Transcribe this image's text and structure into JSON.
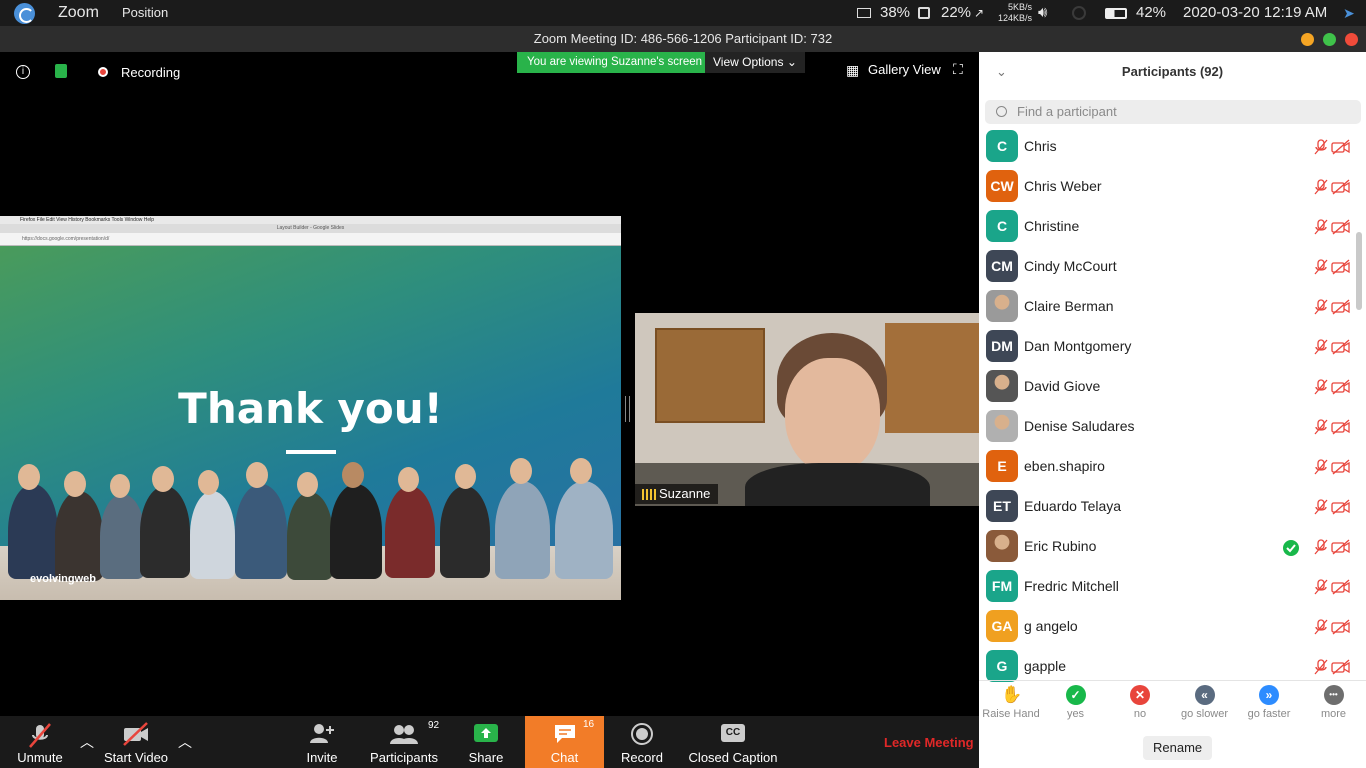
{
  "system": {
    "app_name": "Zoom",
    "menu_position": "Position",
    "battery_indicator": "38%",
    "cpu": "22%",
    "net_up": "5KB/s",
    "net_down": "124KB/s",
    "battery": "42%",
    "datetime": "2020-03-20 12:19 AM"
  },
  "title": "Zoom Meeting ID: 486-566-1206 Participant ID: 732",
  "meeting_controls": {
    "recording": "Recording",
    "viewing_banner": "You are viewing Suzanne's screen",
    "view_options": "View Options",
    "gallery_view": "Gallery View"
  },
  "shared_screen": {
    "browser_menu": "Firefox  File  Edit  View  History  Bookmarks  Tools  Window  Help",
    "browser_tab": "Layout Builder - Google Slides",
    "slide_title": "Thank you!",
    "brand": "evolvingweb"
  },
  "video_tile": {
    "name": "Suzanne"
  },
  "toolbar": {
    "unmute": "Unmute",
    "start_video": "Start Video",
    "invite": "Invite",
    "participants": "Participants",
    "participants_count": "92",
    "share": "Share",
    "chat": "Chat",
    "chat_count": "16",
    "record": "Record",
    "closed_caption": "Closed Caption",
    "cc_icon_text": "CC",
    "leave": "Leave Meeting"
  },
  "panel": {
    "title": "Participants (92)",
    "search_placeholder": "Find a participant",
    "participants": [
      {
        "name": "Chris",
        "initials": "C",
        "color": "#1aa58a",
        "photo": false,
        "check": false
      },
      {
        "name": "Chris Weber",
        "initials": "CW",
        "color": "#e0620e",
        "photo": false,
        "check": false
      },
      {
        "name": "Christine",
        "initials": "C",
        "color": "#1aa58a",
        "photo": false,
        "check": false
      },
      {
        "name": "Cindy McCourt",
        "initials": "CM",
        "color": "#3e4756",
        "photo": false,
        "check": false
      },
      {
        "name": "Claire Berman",
        "initials": "",
        "color": "#9a9a9a",
        "photo": true,
        "check": false
      },
      {
        "name": "Dan Montgomery",
        "initials": "DM",
        "color": "#3e4756",
        "photo": false,
        "check": false
      },
      {
        "name": "David Giove",
        "initials": "",
        "color": "#555555",
        "photo": true,
        "check": false
      },
      {
        "name": "Denise Saludares",
        "initials": "",
        "color": "#b0b0b0",
        "photo": true,
        "check": false
      },
      {
        "name": "eben.shapiro",
        "initials": "E",
        "color": "#e0620e",
        "photo": false,
        "check": false
      },
      {
        "name": "Eduardo Telaya",
        "initials": "ET",
        "color": "#3e4756",
        "photo": false,
        "check": false
      },
      {
        "name": "Eric Rubino",
        "initials": "",
        "color": "#8a5a3a",
        "photo": true,
        "check": true
      },
      {
        "name": "Fredric Mitchell",
        "initials": "FM",
        "color": "#1aa58a",
        "photo": false,
        "check": false
      },
      {
        "name": "g angelo",
        "initials": "GA",
        "color": "#f0a020",
        "photo": false,
        "check": false
      },
      {
        "name": "gapple",
        "initials": "G",
        "color": "#1aa58a",
        "photo": false,
        "check": false
      }
    ],
    "feedback": [
      {
        "label": "Raise Hand",
        "color": "#2d8cff"
      },
      {
        "label": "yes",
        "color": "#18b84a"
      },
      {
        "label": "no",
        "color": "#e8453c"
      },
      {
        "label": "go slower",
        "color": "#5a6b80"
      },
      {
        "label": "go faster",
        "color": "#2d8cff"
      },
      {
        "label": "more",
        "color": "#6e6e6e"
      }
    ],
    "rename": "Rename"
  }
}
